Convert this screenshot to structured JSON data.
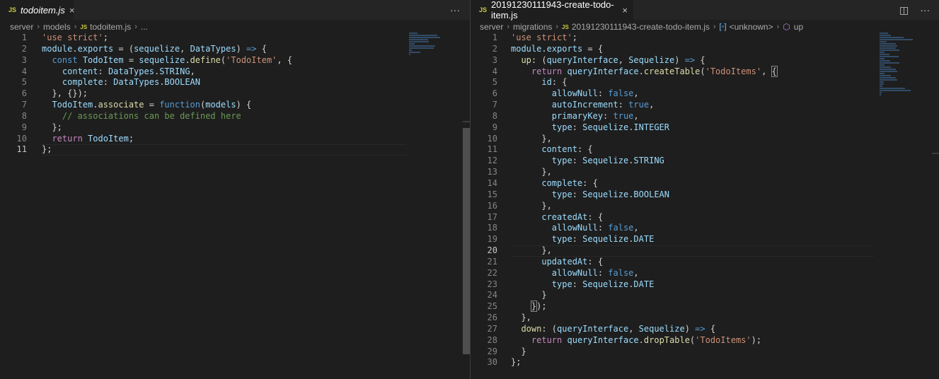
{
  "left": {
    "tab": {
      "icon": "JS",
      "label": "todoitem.js",
      "close": "×"
    },
    "actions": {
      "more": "···"
    },
    "breadcrumb": {
      "parts": [
        "server",
        "models"
      ],
      "file": "todoitem.js",
      "tail": "..."
    },
    "code": [
      [
        [
          "s",
          "'use strict'"
        ],
        [
          "p",
          ";"
        ]
      ],
      [
        [
          "v",
          "module"
        ],
        [
          "p",
          "."
        ],
        [
          "v",
          "exports"
        ],
        [
          "p",
          " = ("
        ],
        [
          "v",
          "sequelize"
        ],
        [
          "p",
          ", "
        ],
        [
          "v",
          "DataTypes"
        ],
        [
          "p",
          ") "
        ],
        [
          "k",
          "=>"
        ],
        [
          "p",
          " {"
        ]
      ],
      [
        [
          "p",
          "  "
        ],
        [
          "k",
          "const"
        ],
        [
          "p",
          " "
        ],
        [
          "v",
          "TodoItem"
        ],
        [
          "p",
          " = "
        ],
        [
          "v",
          "sequelize"
        ],
        [
          "p",
          "."
        ],
        [
          "f",
          "define"
        ],
        [
          "p",
          "("
        ],
        [
          "s",
          "'TodoItem'"
        ],
        [
          "p",
          ", {"
        ]
      ],
      [
        [
          "p",
          "    "
        ],
        [
          "v",
          "content"
        ],
        [
          "p",
          ": "
        ],
        [
          "v",
          "DataTypes"
        ],
        [
          "p",
          "."
        ],
        [
          "v",
          "STRING"
        ],
        [
          "p",
          ","
        ]
      ],
      [
        [
          "p",
          "    "
        ],
        [
          "v",
          "complete"
        ],
        [
          "p",
          ": "
        ],
        [
          "v",
          "DataTypes"
        ],
        [
          "p",
          "."
        ],
        [
          "v",
          "BOOLEAN"
        ]
      ],
      [
        [
          "p",
          "  }, {});"
        ]
      ],
      [
        [
          "p",
          "  "
        ],
        [
          "v",
          "TodoItem"
        ],
        [
          "p",
          "."
        ],
        [
          "f",
          "associate"
        ],
        [
          "p",
          " = "
        ],
        [
          "k",
          "function"
        ],
        [
          "p",
          "("
        ],
        [
          "v",
          "models"
        ],
        [
          "p",
          ") {"
        ]
      ],
      [
        [
          "p",
          "    "
        ],
        [
          "c",
          "// associations can be defined here"
        ]
      ],
      [
        [
          "p",
          "  };"
        ]
      ],
      [
        [
          "p",
          "  "
        ],
        [
          "kc",
          "return"
        ],
        [
          "p",
          " "
        ],
        [
          "v",
          "TodoItem"
        ],
        [
          "p",
          ";"
        ]
      ],
      [
        [
          "p",
          "};"
        ]
      ]
    ]
  },
  "right": {
    "tab": {
      "icon": "JS",
      "label": "20191230111943-create-todo-item.js",
      "close": "×"
    },
    "actions": {
      "split": "◫",
      "more": "···"
    },
    "breadcrumb": {
      "parts": [
        "server",
        "migrations"
      ],
      "file": "20191230111943-create-todo-item.js",
      "symbol": "<unknown>",
      "method": "up"
    },
    "code": [
      [
        [
          "s",
          "'use strict'"
        ],
        [
          "p",
          ";"
        ]
      ],
      [
        [
          "v",
          "module"
        ],
        [
          "p",
          "."
        ],
        [
          "v",
          "exports"
        ],
        [
          "p",
          " = {"
        ]
      ],
      [
        [
          "p",
          "  "
        ],
        [
          "f",
          "up"
        ],
        [
          "p",
          ": ("
        ],
        [
          "v",
          "queryInterface"
        ],
        [
          "p",
          ", "
        ],
        [
          "v",
          "Sequelize"
        ],
        [
          "p",
          ") "
        ],
        [
          "k",
          "=>"
        ],
        [
          "p",
          " {"
        ]
      ],
      [
        [
          "p",
          "    "
        ],
        [
          "kc",
          "return"
        ],
        [
          "p",
          " "
        ],
        [
          "v",
          "queryInterface"
        ],
        [
          "p",
          "."
        ],
        [
          "f",
          "createTable"
        ],
        [
          "p",
          "("
        ],
        [
          "s",
          "'TodoItems'"
        ],
        [
          "p",
          ", "
        ],
        [
          "bm",
          "{"
        ]
      ],
      [
        [
          "p",
          "      "
        ],
        [
          "v",
          "id"
        ],
        [
          "p",
          ": {"
        ]
      ],
      [
        [
          "p",
          "        "
        ],
        [
          "v",
          "allowNull"
        ],
        [
          "p",
          ": "
        ],
        [
          "k",
          "false"
        ],
        [
          "p",
          ","
        ]
      ],
      [
        [
          "p",
          "        "
        ],
        [
          "v",
          "autoIncrement"
        ],
        [
          "p",
          ": "
        ],
        [
          "k",
          "true"
        ],
        [
          "p",
          ","
        ]
      ],
      [
        [
          "p",
          "        "
        ],
        [
          "v",
          "primaryKey"
        ],
        [
          "p",
          ": "
        ],
        [
          "k",
          "true"
        ],
        [
          "p",
          ","
        ]
      ],
      [
        [
          "p",
          "        "
        ],
        [
          "v",
          "type"
        ],
        [
          "p",
          ": "
        ],
        [
          "v",
          "Sequelize"
        ],
        [
          "p",
          "."
        ],
        [
          "v",
          "INTEGER"
        ]
      ],
      [
        [
          "p",
          "      },"
        ]
      ],
      [
        [
          "p",
          "      "
        ],
        [
          "v",
          "content"
        ],
        [
          "p",
          ": {"
        ]
      ],
      [
        [
          "p",
          "        "
        ],
        [
          "v",
          "type"
        ],
        [
          "p",
          ": "
        ],
        [
          "v",
          "Sequelize"
        ],
        [
          "p",
          "."
        ],
        [
          "v",
          "STRING"
        ]
      ],
      [
        [
          "p",
          "      },"
        ]
      ],
      [
        [
          "p",
          "      "
        ],
        [
          "v",
          "complete"
        ],
        [
          "p",
          ": {"
        ]
      ],
      [
        [
          "p",
          "        "
        ],
        [
          "v",
          "type"
        ],
        [
          "p",
          ": "
        ],
        [
          "v",
          "Sequelize"
        ],
        [
          "p",
          "."
        ],
        [
          "v",
          "BOOLEAN"
        ]
      ],
      [
        [
          "p",
          "      },"
        ]
      ],
      [
        [
          "p",
          "      "
        ],
        [
          "v",
          "createdAt"
        ],
        [
          "p",
          ": {"
        ]
      ],
      [
        [
          "p",
          "        "
        ],
        [
          "v",
          "allowNull"
        ],
        [
          "p",
          ": "
        ],
        [
          "k",
          "false"
        ],
        [
          "p",
          ","
        ]
      ],
      [
        [
          "p",
          "        "
        ],
        [
          "v",
          "type"
        ],
        [
          "p",
          ": "
        ],
        [
          "v",
          "Sequelize"
        ],
        [
          "p",
          "."
        ],
        [
          "v",
          "DATE"
        ]
      ],
      [
        [
          "p",
          "      },"
        ]
      ],
      [
        [
          "p",
          "      "
        ],
        [
          "v",
          "updatedAt"
        ],
        [
          "p",
          ": {"
        ]
      ],
      [
        [
          "p",
          "        "
        ],
        [
          "v",
          "allowNull"
        ],
        [
          "p",
          ": "
        ],
        [
          "k",
          "false"
        ],
        [
          "p",
          ","
        ]
      ],
      [
        [
          "p",
          "        "
        ],
        [
          "v",
          "type"
        ],
        [
          "p",
          ": "
        ],
        [
          "v",
          "Sequelize"
        ],
        [
          "p",
          "."
        ],
        [
          "v",
          "DATE"
        ]
      ],
      [
        [
          "p",
          "      }"
        ]
      ],
      [
        [
          "p",
          "    "
        ],
        [
          "bm",
          "}"
        ],
        [
          "p",
          ");"
        ]
      ],
      [
        [
          "p",
          "  },"
        ]
      ],
      [
        [
          "p",
          "  "
        ],
        [
          "f",
          "down"
        ],
        [
          "p",
          ": ("
        ],
        [
          "v",
          "queryInterface"
        ],
        [
          "p",
          ", "
        ],
        [
          "v",
          "Sequelize"
        ],
        [
          "p",
          ") "
        ],
        [
          "k",
          "=>"
        ],
        [
          "p",
          " {"
        ]
      ],
      [
        [
          "p",
          "    "
        ],
        [
          "kc",
          "return"
        ],
        [
          "p",
          " "
        ],
        [
          "v",
          "queryInterface"
        ],
        [
          "p",
          "."
        ],
        [
          "f",
          "dropTable"
        ],
        [
          "p",
          "("
        ],
        [
          "s",
          "'TodoItems'"
        ],
        [
          "p",
          ");"
        ]
      ],
      [
        [
          "p",
          "  }"
        ]
      ],
      [
        [
          "p",
          "};"
        ]
      ]
    ]
  }
}
